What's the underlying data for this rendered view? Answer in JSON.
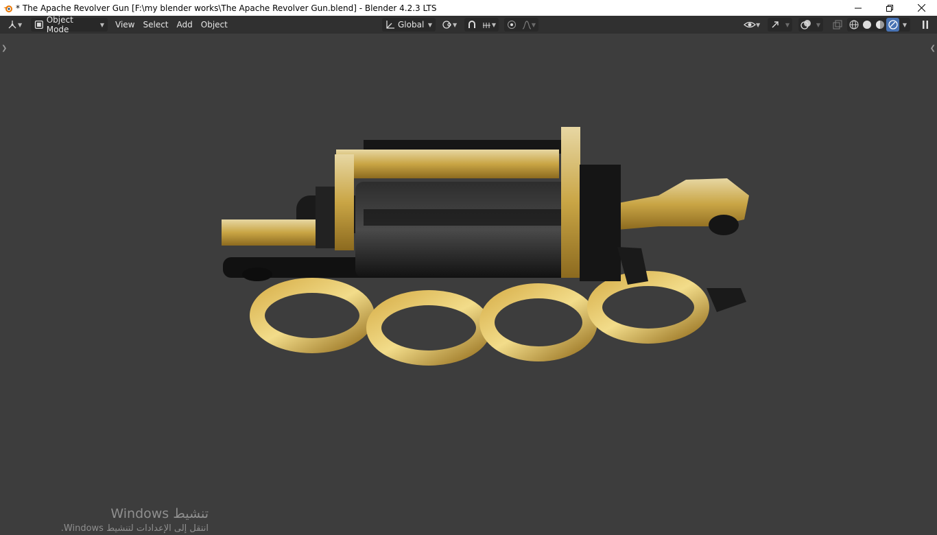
{
  "window": {
    "title": "* The Apache Revolver Gun [F:\\my blender works\\The Apache Revolver Gun.blend] - Blender 4.2.3 LTS",
    "controls": [
      "minimize-icon",
      "restore-icon",
      "close-icon"
    ]
  },
  "header": {
    "editor_type_icon": "3d-viewport-icon",
    "mode": {
      "icon": "object-mode-icon",
      "label": "Object Mode"
    },
    "menus": [
      "View",
      "Select",
      "Add",
      "Object"
    ],
    "orientation": {
      "icon": "transform-orientation-icon",
      "label": "Global"
    },
    "pivot_icon": "pivot-point-icon",
    "snap_icon": "snap-magnet-icon",
    "snap_target_icon": "snap-increment-icon",
    "proportional_icon": "proportional-editing-icon",
    "falloff_icon": "falloff-curve-icon",
    "visibility_icon": "object-visibility-icon",
    "gizmo_icon": "gizmo-icon",
    "overlay_icon": "overlay-icon",
    "xray_icon": "xray-icon",
    "shading_modes": [
      "wireframe",
      "solid",
      "material-preview",
      "rendered"
    ],
    "active_shading": "rendered",
    "sidebar_icon": "sidebar-toggle-icon"
  },
  "viewport": {
    "object": "The Apache Revolver Gun",
    "left_toggle_icon": "expand-toolbar-arrow-icon",
    "right_toggle_icon": "collapse-sidebar-arrow-icon"
  },
  "activation": {
    "title": "تنشيط Windows",
    "subtitle": "انتقل إلى الإعدادات لتنشيط Windows."
  },
  "colors": {
    "accent": "#4772b3",
    "viewport_bg": "#3d3d3d",
    "header_bg": "#303030",
    "gold": "#c9a545",
    "gunmetal": "#1c1c1c"
  }
}
